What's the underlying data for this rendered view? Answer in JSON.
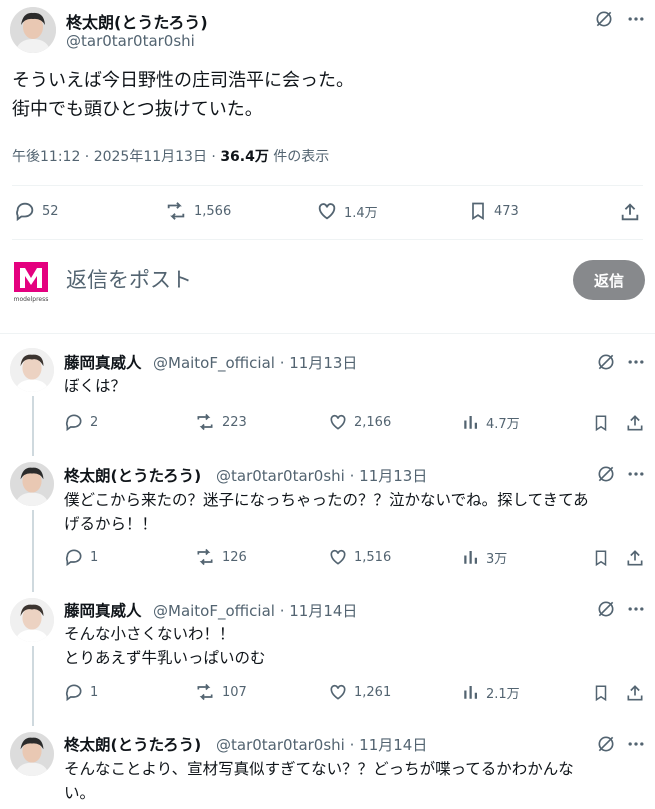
{
  "main_post": {
    "display_name": "柊太朗(とうたろう)",
    "handle": "@tar0tar0tar0shi",
    "text": "そういえば今日野性の庄司浩平に会った。\n街中でも頭ひとつ抜けていた。",
    "time": "午後11:12 · 2025年11月13日 · ",
    "views_count": "36.4万",
    "views_label": " 件の表示",
    "replies": "52",
    "reposts": "1,566",
    "likes": "1.4万",
    "bookmarks": "473"
  },
  "reply_bar": {
    "logo_text": "modelpress",
    "placeholder": "返信をポスト",
    "button": "返信"
  },
  "thread": [
    {
      "display_name": "藤岡真威人",
      "handle": "@MaitoF_official · 11月13日",
      "text": "ぼくは？",
      "replies": "2",
      "reposts": "223",
      "likes": "2,166",
      "views": "4.7万"
    },
    {
      "display_name": "柊太朗(とうたろう)",
      "handle": "@tar0tar0tar0shi · 11月13日",
      "text": "僕どこから来たの？迷子になっちゃったの？？泣かないでね。探してきてあ\nげるから！！",
      "replies": "1",
      "reposts": "126",
      "likes": "1,516",
      "views": "3万"
    },
    {
      "display_name": "藤岡真威人",
      "handle": "@MaitoF_official · 11月14日",
      "text": "そんな小さくないわ！！\nとりあえず牛乳いっぱいのむ",
      "replies": "1",
      "reposts": "107",
      "likes": "1,261",
      "views": "2.1万"
    },
    {
      "display_name": "柊太朗(とうたろう)",
      "handle": "@tar0tar0tar0shi · 11月14日",
      "text": "そんなことより、宣材写真似すぎてない？？どっちが喋ってるかわかんな\nい。"
    }
  ],
  "colors": {
    "text": "#0f1419",
    "secondary": "#536471",
    "divider": "#eff3f4",
    "reply_button": "#87898c",
    "modelpress_pink": "#e4007f"
  },
  "icons": [
    "grok-icon",
    "more-icon",
    "reply-icon",
    "repost-icon",
    "like-icon",
    "views-icon",
    "bookmark-icon",
    "share-icon"
  ]
}
